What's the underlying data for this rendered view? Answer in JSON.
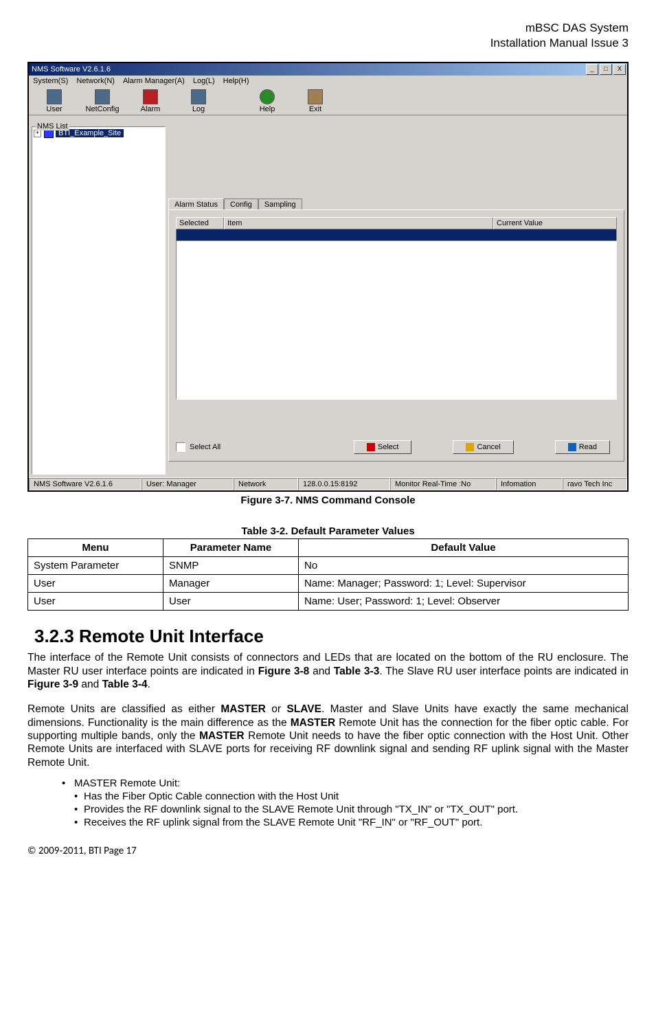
{
  "doc_header": {
    "line1": "mBSC DAS System",
    "line2": "Installation Manual Issue 3"
  },
  "screenshot": {
    "titlebar": "NMS Software V2.6.1.6",
    "win_btns": {
      "min": "_",
      "max": "□",
      "close": "X"
    },
    "menubar": [
      "System(S)",
      "Network(N)",
      "Alarm Manager(A)",
      "Log(L)",
      "Help(H)"
    ],
    "toolbar": [
      {
        "label": "User"
      },
      {
        "label": "NetConfig"
      },
      {
        "label": "Alarm"
      },
      {
        "label": "Log"
      },
      {
        "label": "Help"
      },
      {
        "label": "Exit"
      }
    ],
    "nms_list_label": "NMS List",
    "tree_expander": "+",
    "tree_item": "BTI_Example_Site",
    "tabs": [
      "Alarm Status",
      "Config",
      "Sampling"
    ],
    "grid_headers": {
      "selected": "Selected",
      "item": "Item",
      "value": "Current Value"
    },
    "select_all": "Select All",
    "btn_select": "Select",
    "btn_cancel": "Cancel",
    "btn_read": "Read",
    "status": {
      "app": "NMS Software V2.6.1.6",
      "user": "User: Manager",
      "network": "Network",
      "addr": "128.0.0.15:8192",
      "monitor": "Monitor Real-Time :No",
      "info": "Infomation",
      "company": "ravo Tech Inc"
    }
  },
  "fig_caption": "Figure 3-7. NMS Command Console",
  "table_caption": "Table 3-2. Default Parameter Values",
  "table": {
    "headers": {
      "menu": "Menu",
      "param": "Parameter Name",
      "default": "Default Value"
    },
    "rows": [
      {
        "menu": "System Parameter",
        "param": "SNMP",
        "default": "No"
      },
      {
        "menu": "User",
        "param": "Manager",
        "default": "Name: Manager; Password: 1; Level: Supervisor"
      },
      {
        "menu": "User",
        "param": "User",
        "default": "Name: User; Password: 1; Level: Observer"
      }
    ]
  },
  "section_heading": "3.2.3  Remote Unit Interface",
  "para1_a": "The interface of the Remote Unit consists of connectors and LEDs that are located on the bottom of the RU enclosure. The Master RU user interface points are indicated in ",
  "para1_b": "Figure 3-8",
  "para1_c": " and ",
  "para1_d": "Table 3-3",
  "para1_e": ". The Slave RU user interface points are indicated in ",
  "para1_f": "Figure 3-9",
  "para1_g": " and ",
  "para1_h": "Table 3-4",
  "para1_i": ".",
  "para2_a": "Remote Units are classified as either ",
  "para2_b": "MASTER",
  "para2_c": " or ",
  "para2_d": "SLAVE",
  "para2_e": ". Master and Slave Units have exactly the same mechanical dimensions. Functionality is the main difference as the ",
  "para2_f": "MASTER",
  "para2_g": " Remote Unit has the connection for the fiber optic cable. For supporting multiple bands, only the ",
  "para2_h": "MASTER",
  "para2_i": " Remote Unit needs to have the fiber optic connection with the Host Unit. Other Remote Units are interfaced with SLAVE ports for receiving RF downlink signal and sending RF uplink signal with the Master Remote Unit.",
  "bullet_master": "MASTER Remote Unit:",
  "sub1": "Has the Fiber Optic Cable connection with the Host Unit",
  "sub2": "Provides the RF downlink signal to the SLAVE Remote Unit through \"TX_IN\" or \"TX_OUT\" port.",
  "sub3": "Receives the RF uplink signal from the SLAVE Remote Unit \"RF_IN\" or \"RF_OUT\" port.",
  "footer": "© 2009‐2011, BTI Page 17"
}
